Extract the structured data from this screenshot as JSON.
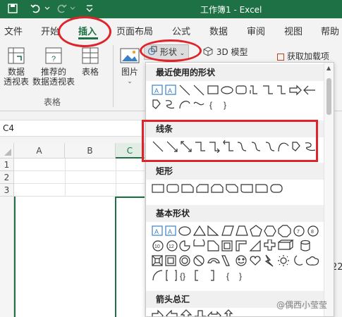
{
  "window": {
    "title": "工作簿1 - Excel"
  },
  "tabs": [
    "文件",
    "开始",
    "插入",
    "页面布局",
    "公式",
    "数据",
    "审阅",
    "视图",
    "帮助"
  ],
  "active_tab": "插入",
  "ribbon": {
    "pivot_table": "数据\n透视表",
    "recommended_pivot": "推荐的\n数据透视表",
    "table": "表格",
    "group_tables": "表格",
    "pictures": "图片",
    "shapes_button": "形状",
    "model3d": "3D 模型",
    "get_addins": "获取加载项"
  },
  "name_box": {
    "value": "C4"
  },
  "sheet": {
    "columns": [
      "A",
      "B",
      "C"
    ],
    "rows": [
      "1",
      "2",
      "3"
    ],
    "partial_value": "22"
  },
  "dropdown": {
    "sections": [
      "最近使用的形状",
      "线条",
      "矩形",
      "基本形状",
      "箭头总汇"
    ]
  },
  "watermark": "@偶西小莹莹",
  "colors": {
    "excel_green": "#1e7145",
    "highlight_red": "#e0232a"
  }
}
